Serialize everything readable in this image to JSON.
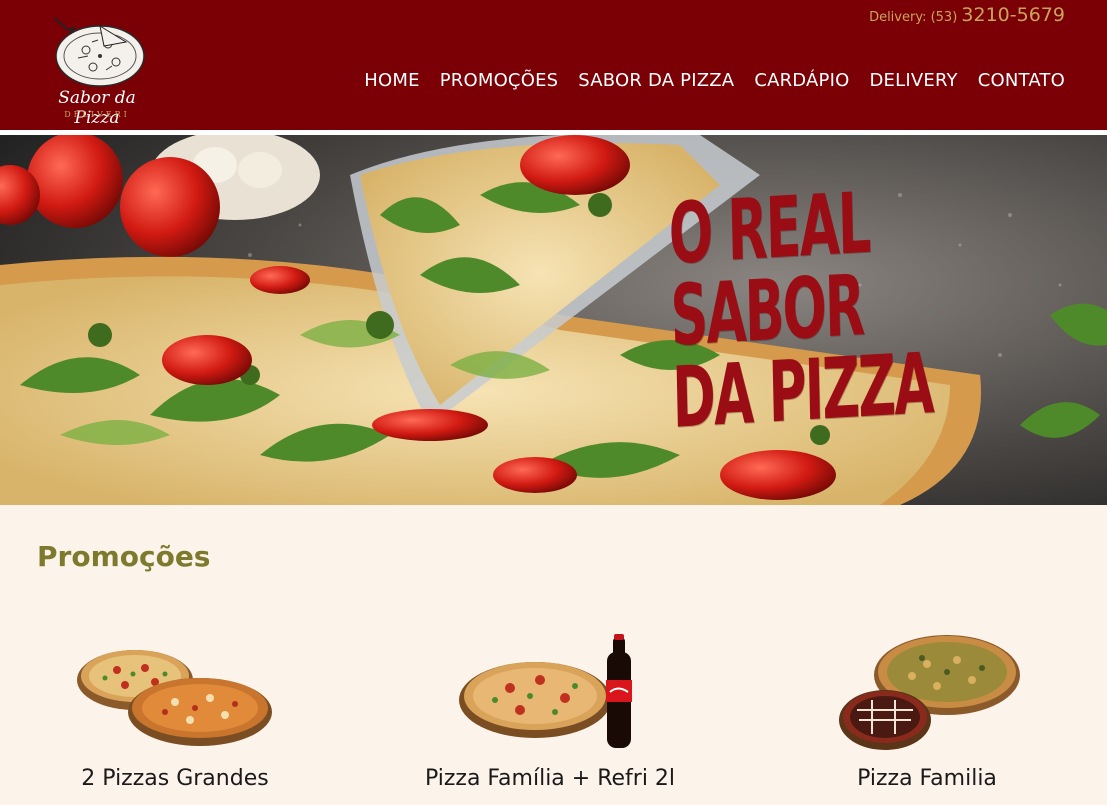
{
  "header": {
    "logo": {
      "name": "Sabor da Pizza",
      "sub": "DELIVERI"
    },
    "phone": {
      "label": "Delivery: (53)",
      "number": "3210-5679"
    },
    "nav": [
      "HOME",
      "PROMOÇÕES",
      "SABOR DA PIZZA",
      "CARDÁPIO",
      "DELIVERY",
      "CONTATO"
    ]
  },
  "hero": {
    "lines": [
      "O REAL",
      "SABOR",
      "DA PIZZA"
    ]
  },
  "promotions": {
    "title": "Promoções",
    "items": [
      {
        "title": "2 Pizzas Grandes"
      },
      {
        "title": "Pizza Família + Refri 2l"
      },
      {
        "title": "Pizza Familia"
      }
    ]
  },
  "colors": {
    "header": "#7a0006",
    "accent": "#c9a45c",
    "hero_text": "#9b0d15",
    "section_title": "#7d7a2e",
    "background": "#fcf3ea"
  }
}
